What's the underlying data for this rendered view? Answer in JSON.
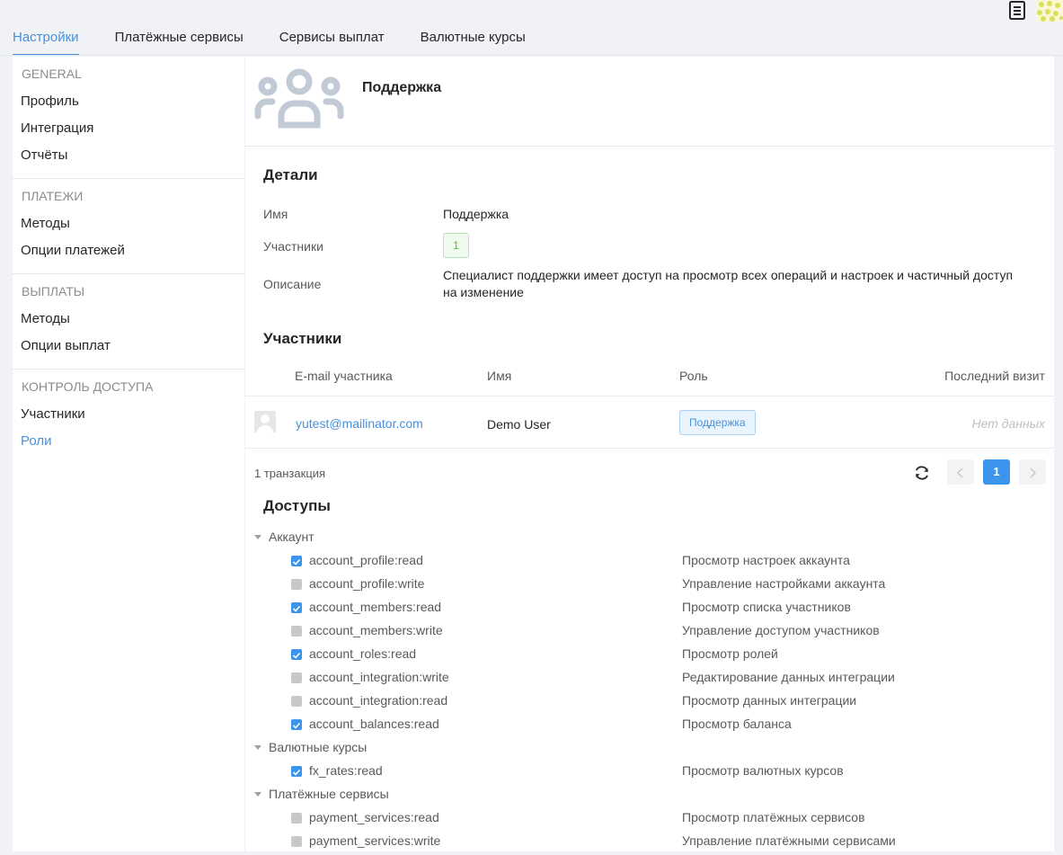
{
  "tabs": [
    {
      "label": "Настройки",
      "active": true
    },
    {
      "label": "Платёжные сервисы",
      "active": false
    },
    {
      "label": "Сервисы выплат",
      "active": false
    },
    {
      "label": "Валютные курсы",
      "active": false
    }
  ],
  "sidebar": {
    "groups": [
      {
        "title": "GENERAL",
        "items": [
          {
            "label": "Профиль"
          },
          {
            "label": "Интеграция"
          },
          {
            "label": "Отчёты"
          }
        ]
      },
      {
        "title": "ПЛАТЕЖИ",
        "items": [
          {
            "label": "Методы"
          },
          {
            "label": "Опции платежей"
          }
        ]
      },
      {
        "title": "ВЫПЛАТЫ",
        "items": [
          {
            "label": "Методы"
          },
          {
            "label": "Опции выплат"
          }
        ]
      },
      {
        "title": "КОНТРОЛЬ ДОСТУПА",
        "items": [
          {
            "label": "Участники"
          },
          {
            "label": "Роли",
            "active": true
          }
        ]
      }
    ]
  },
  "role": {
    "title": "Поддержка"
  },
  "details": {
    "title": "Детали",
    "name_label": "Имя",
    "name_value": "Поддержка",
    "members_label": "Участники",
    "members_count": "1",
    "description_label": "Описание",
    "description_value": "Специалист поддержки имеет доступ на просмотр всех операций и настроек и частичный доступ на изменение"
  },
  "members": {
    "title": "Участники",
    "columns": {
      "email": "E-mail участника",
      "name": "Имя",
      "role": "Роль",
      "last_visit": "Последний визит"
    },
    "rows": [
      {
        "email": "yutest@mailinator.com",
        "name": "Demo User",
        "role": "Поддержка",
        "last_visit": "Нет данных"
      }
    ],
    "total": "1 транзакция",
    "current_page": "1"
  },
  "access": {
    "title": "Доступы",
    "categories": [
      {
        "name": "Аккаунт",
        "perms": [
          {
            "code": "account_profile:read",
            "desc": "Просмотр настроек аккаунта",
            "checked": true
          },
          {
            "code": "account_profile:write",
            "desc": "Управление настройками аккаунта",
            "checked": false
          },
          {
            "code": "account_members:read",
            "desc": "Просмотр списка участников",
            "checked": true
          },
          {
            "code": "account_members:write",
            "desc": "Управление доступом участников",
            "checked": false
          },
          {
            "code": "account_roles:read",
            "desc": "Просмотр ролей",
            "checked": true
          },
          {
            "code": "account_integration:write",
            "desc": "Редактирование данных интеграции",
            "checked": false
          },
          {
            "code": "account_integration:read",
            "desc": "Просмотр данных интеграции",
            "checked": false
          },
          {
            "code": "account_balances:read",
            "desc": "Просмотр баланса",
            "checked": true
          }
        ]
      },
      {
        "name": "Валютные курсы",
        "perms": [
          {
            "code": "fx_rates:read",
            "desc": "Просмотр валютных курсов",
            "checked": true
          }
        ]
      },
      {
        "name": "Платёжные сервисы",
        "perms": [
          {
            "code": "payment_services:read",
            "desc": "Просмотр платёжных сервисов",
            "checked": false
          },
          {
            "code": "payment_services:write",
            "desc": "Управление платёжными сервисами",
            "checked": false
          }
        ]
      }
    ]
  },
  "colors": {
    "accent": "#4a90d9",
    "primary_button": "#3b95ec",
    "success": "#52c41a"
  }
}
